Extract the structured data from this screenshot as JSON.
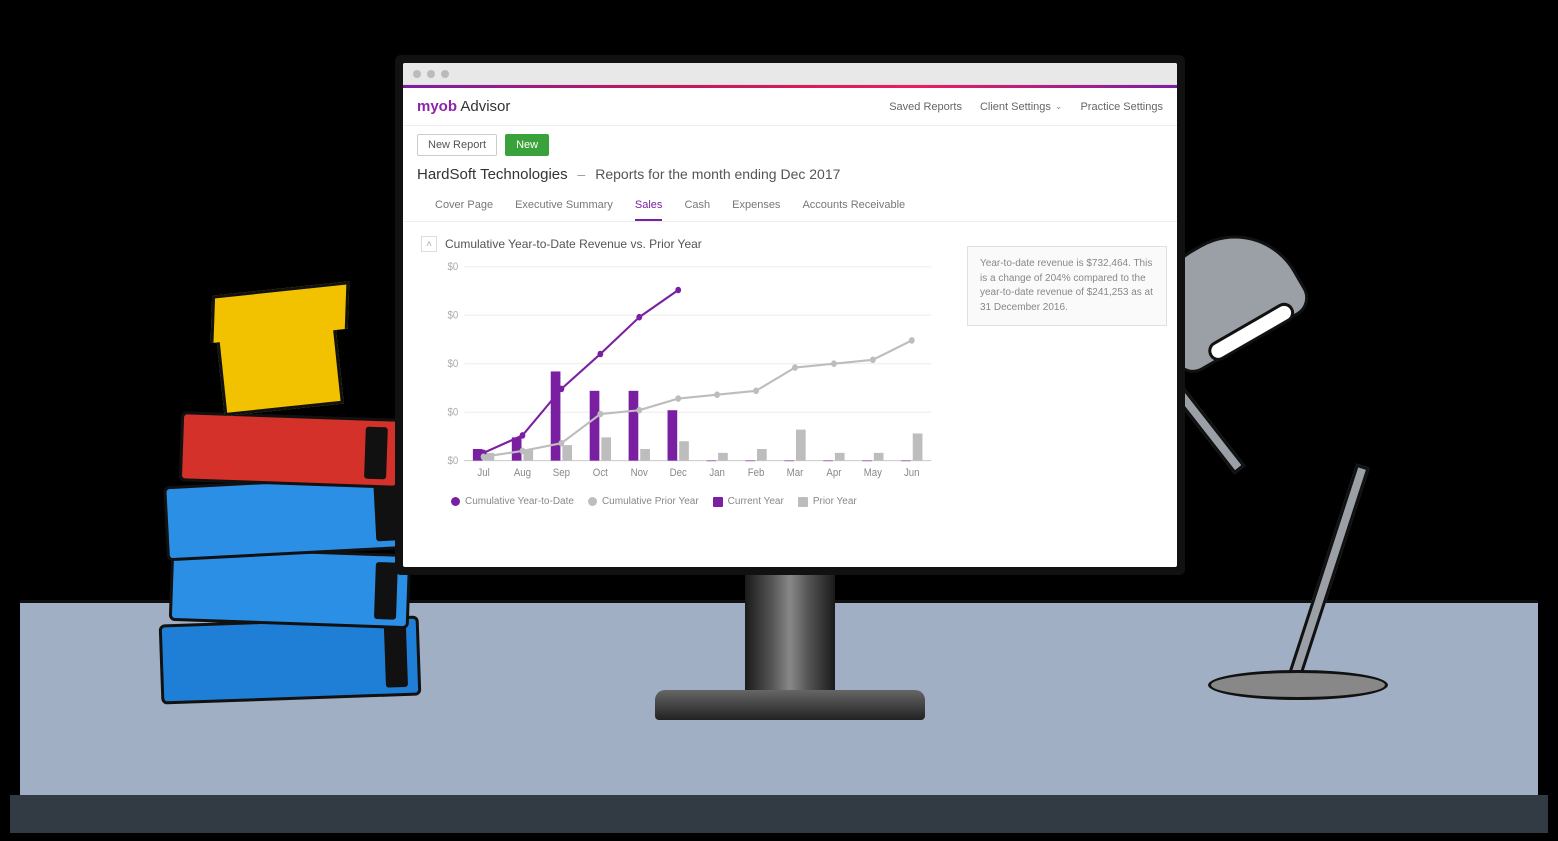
{
  "brand": {
    "bold": "myob",
    "light": "Advisor"
  },
  "top_nav": {
    "saved_reports": "Saved Reports",
    "client_settings": "Client Settings",
    "practice_settings": "Practice Settings"
  },
  "toolbar": {
    "new_report": "New Report",
    "new": "New"
  },
  "title": {
    "company": "HardSoft Technologies",
    "subtitle": "Reports for the month ending Dec 2017"
  },
  "tabs": [
    {
      "label": "Cover Page",
      "active": false
    },
    {
      "label": "Executive Summary",
      "active": false
    },
    {
      "label": "Sales",
      "active": true
    },
    {
      "label": "Cash",
      "active": false
    },
    {
      "label": "Expenses",
      "active": false
    },
    {
      "label": "Accounts Receivable",
      "active": false
    }
  ],
  "chart": {
    "title": "Cumulative Year-to-Date Revenue vs. Prior Year",
    "y_tick_label": "$0",
    "legend": {
      "cum_current": "Cumulative Year-to-Date",
      "cum_prior": "Cumulative Prior Year",
      "current": "Current Year",
      "prior": "Prior Year"
    },
    "colors": {
      "current": "#7b1fa2",
      "prior": "#bdbdbd"
    }
  },
  "insight": "Year-to-date revenue is $732,464. This is a change of 204% compared to the year-to-date revenue of $241,253 as at 31 December 2016.",
  "chart_data": {
    "type": "bar",
    "title": "Cumulative Year-to-Date Revenue vs. Prior Year",
    "categories": [
      "Jul",
      "Aug",
      "Sep",
      "Oct",
      "Nov",
      "Dec",
      "Jan",
      "Feb",
      "Mar",
      "Apr",
      "May",
      "Jun"
    ],
    "xlabel": "",
    "ylabel": "",
    "ylim": [
      0,
      100
    ],
    "series": [
      {
        "name": "Cumulative Year-to-Date",
        "kind": "line",
        "values": [
          4,
          13,
          37,
          55,
          74,
          88,
          null,
          null,
          null,
          null,
          null,
          null
        ]
      },
      {
        "name": "Cumulative Prior Year",
        "kind": "line",
        "values": [
          2,
          5,
          9,
          24,
          26,
          32,
          34,
          36,
          48,
          50,
          52,
          62
        ]
      },
      {
        "name": "Current Year",
        "kind": "bar",
        "values": [
          6,
          12,
          46,
          36,
          36,
          26,
          0,
          0,
          0,
          0,
          0,
          0
        ]
      },
      {
        "name": "Prior Year",
        "kind": "bar",
        "values": [
          4,
          6,
          8,
          12,
          6,
          10,
          4,
          6,
          16,
          4,
          4,
          14
        ]
      }
    ]
  }
}
